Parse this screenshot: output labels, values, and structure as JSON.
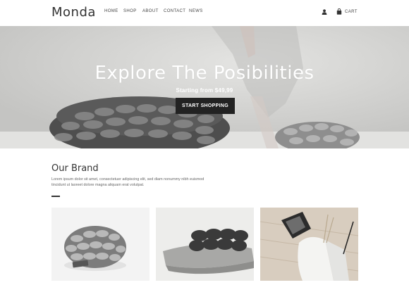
{
  "header": {
    "logo": "Monda",
    "nav": [
      "HOME",
      "SHOP",
      "ABOUT",
      "CONTACT",
      "NEWS"
    ],
    "cart_label": "CART",
    "icons": {
      "account": "user-icon",
      "cart": "shopping-bag-icon"
    }
  },
  "hero": {
    "title": "Explore The Posibilities",
    "subtitle": "Starting from $49,99",
    "button_label": "START SHOPPING"
  },
  "brand": {
    "title": "Our Brand",
    "text": "Lorem ipsum dolor sit amet, consectetuer adipiscing elit, sed diam nonummy nibh euismod tincidunt ut laoreet dolore magna aliquam erat volutpat."
  },
  "products": [
    {
      "name": "knit-pouf-product"
    },
    {
      "name": "knit-cushion-product"
    },
    {
      "name": "decor-vase-product"
    }
  ],
  "colors": {
    "button": "#222222",
    "text": "#333333",
    "hero_text": "#ffffff"
  }
}
